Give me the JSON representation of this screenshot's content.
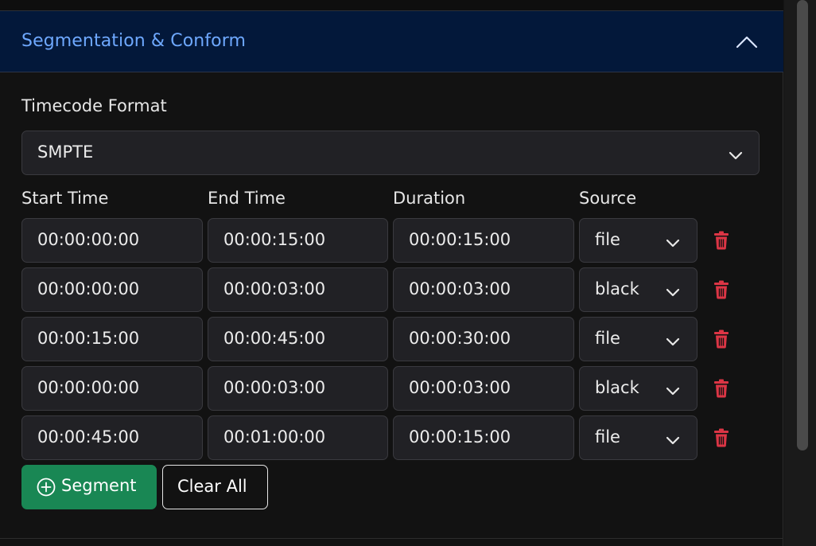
{
  "accordion": {
    "title": "Segmentation & Conform",
    "toggle_icon": "chevron-up-icon",
    "accent_color": "#6ea8fe"
  },
  "timecode": {
    "label": "Timecode Format",
    "selected": "SMPTE",
    "icon": "chevron-down-icon"
  },
  "columns": {
    "start": "Start Time",
    "end": "End Time",
    "duration": "Duration",
    "source": "Source"
  },
  "segments": [
    {
      "start": "00:00:00:00",
      "end": "00:00:15:00",
      "duration": "00:00:15:00",
      "source": "file"
    },
    {
      "start": "00:00:00:00",
      "end": "00:00:03:00",
      "duration": "00:00:03:00",
      "source": "black"
    },
    {
      "start": "00:00:15:00",
      "end": "00:00:45:00",
      "duration": "00:00:30:00",
      "source": "file"
    },
    {
      "start": "00:00:00:00",
      "end": "00:00:03:00",
      "duration": "00:00:03:00",
      "source": "black"
    },
    {
      "start": "00:00:45:00",
      "end": "00:01:00:00",
      "duration": "00:00:15:00",
      "source": "file"
    }
  ],
  "actions": {
    "add_label": "Segment",
    "add_icon": "plus-circle-icon",
    "clear_label": "Clear All",
    "delete_icon": "trash-icon"
  },
  "colors": {
    "success": "#198754",
    "danger": "#dc3545",
    "header_bg": "#03183a"
  }
}
